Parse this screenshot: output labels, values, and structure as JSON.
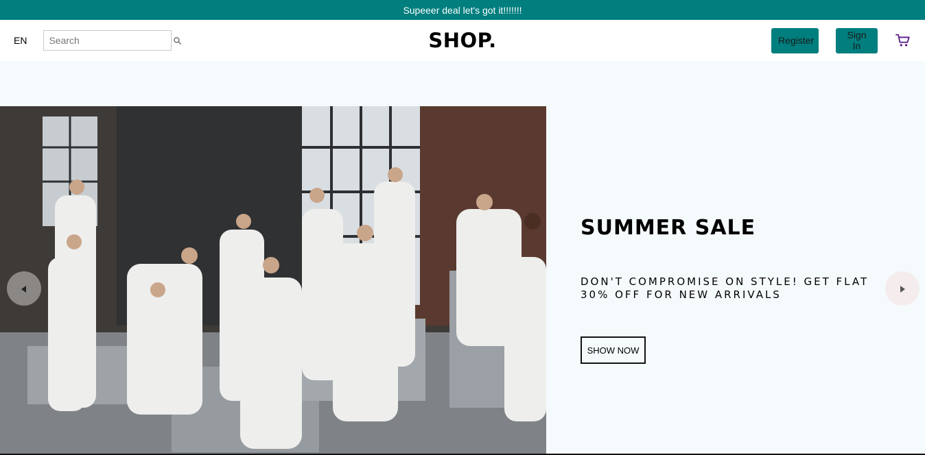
{
  "announcement": {
    "text": "Supeeer deal let's got it!!!!!!!"
  },
  "navbar": {
    "language": "EN",
    "search": {
      "placeholder": "Search",
      "value": ""
    },
    "logo": "SHOP.",
    "register_label": "Register",
    "signin_label": "Sign In",
    "cart_icon": "shopping-cart-icon",
    "search_icon": "magnifier-icon"
  },
  "slider": {
    "slide": {
      "title": "SUMMER SALE",
      "description": "DON'T COMPROMISE ON STYLE! GET FLAT 30% OFF FOR NEW ARRIVALS",
      "button_label": "SHOW NOW"
    },
    "prev_icon": "arrow-left-icon",
    "next_icon": "arrow-right-icon"
  },
  "colors": {
    "accent": "#017e7e",
    "cart_icon": "#5a1a8a",
    "page_background": "#f5fafd",
    "announcement_text": "#ffffff"
  }
}
